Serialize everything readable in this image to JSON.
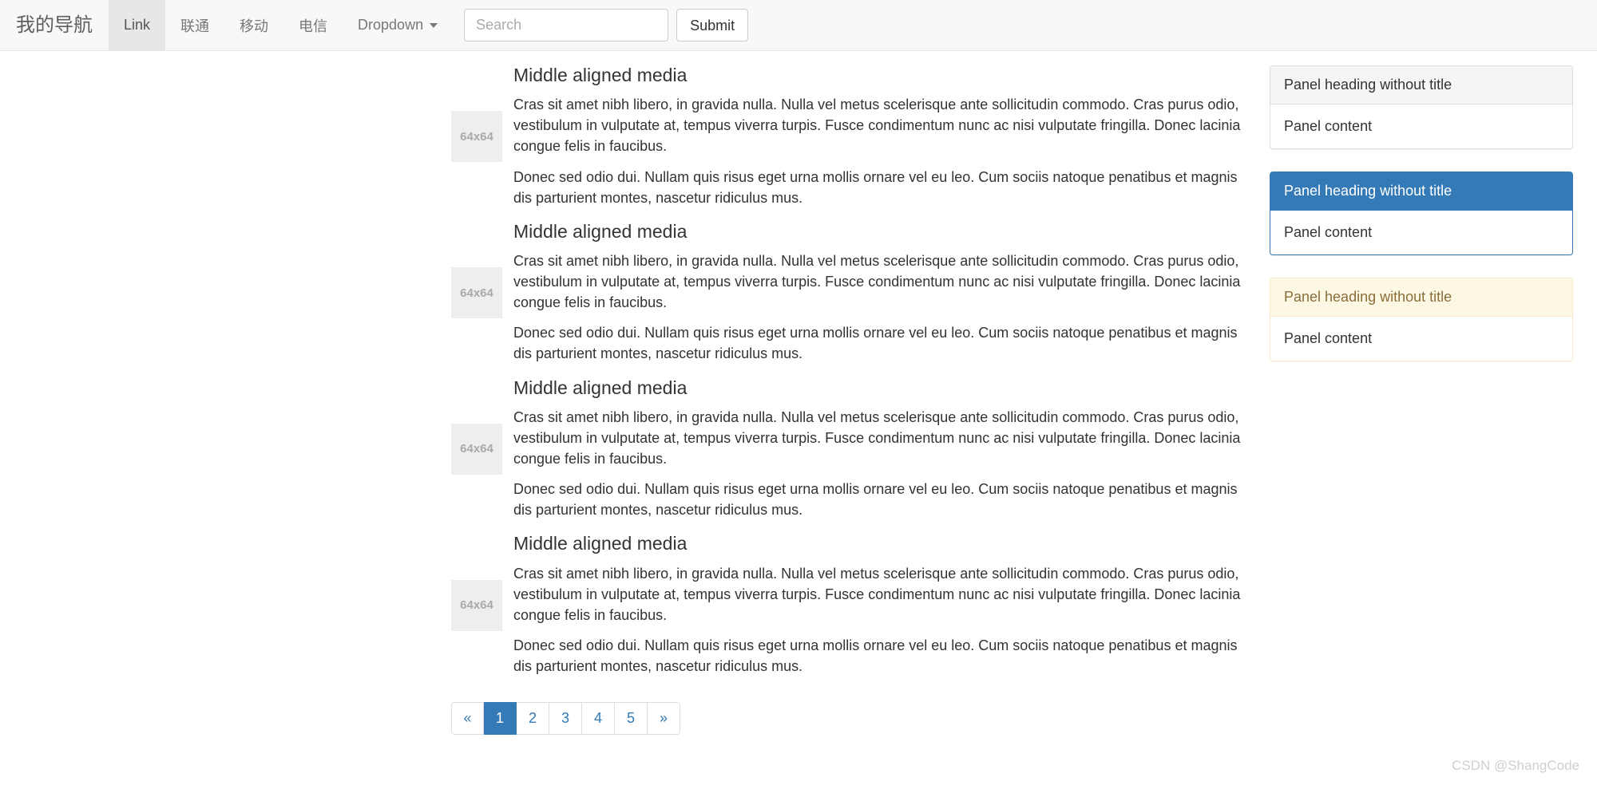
{
  "navbar": {
    "brand": "我的导航",
    "items": [
      {
        "label": "Link",
        "active": true,
        "dropdown": false
      },
      {
        "label": "联通",
        "active": false,
        "dropdown": false
      },
      {
        "label": "移动",
        "active": false,
        "dropdown": false
      },
      {
        "label": "电信",
        "active": false,
        "dropdown": false
      },
      {
        "label": "Dropdown",
        "active": false,
        "dropdown": true
      }
    ],
    "search": {
      "value": "",
      "placeholder": "Search"
    },
    "submit_label": "Submit"
  },
  "media_list": [
    {
      "thumb_label": "64x64",
      "heading": "Middle aligned media",
      "paragraph1": "Cras sit amet nibh libero, in gravida nulla. Nulla vel metus scelerisque ante sollicitudin commodo. Cras purus odio, vestibulum in vulputate at, tempus viverra turpis. Fusce condimentum nunc ac nisi vulputate fringilla. Donec lacinia congue felis in faucibus.",
      "paragraph2": "Donec sed odio dui. Nullam quis risus eget urna mollis ornare vel eu leo. Cum sociis natoque penatibus et magnis dis parturient montes, nascetur ridiculus mus."
    },
    {
      "thumb_label": "64x64",
      "heading": "Middle aligned media",
      "paragraph1": "Cras sit amet nibh libero, in gravida nulla. Nulla vel metus scelerisque ante sollicitudin commodo. Cras purus odio, vestibulum in vulputate at, tempus viverra turpis. Fusce condimentum nunc ac nisi vulputate fringilla. Donec lacinia congue felis in faucibus.",
      "paragraph2": "Donec sed odio dui. Nullam quis risus eget urna mollis ornare vel eu leo. Cum sociis natoque penatibus et magnis dis parturient montes, nascetur ridiculus mus."
    },
    {
      "thumb_label": "64x64",
      "heading": "Middle aligned media",
      "paragraph1": "Cras sit amet nibh libero, in gravida nulla. Nulla vel metus scelerisque ante sollicitudin commodo. Cras purus odio, vestibulum in vulputate at, tempus viverra turpis. Fusce condimentum nunc ac nisi vulputate fringilla. Donec lacinia congue felis in faucibus.",
      "paragraph2": "Donec sed odio dui. Nullam quis risus eget urna mollis ornare vel eu leo. Cum sociis natoque penatibus et magnis dis parturient montes, nascetur ridiculus mus."
    },
    {
      "thumb_label": "64x64",
      "heading": "Middle aligned media",
      "paragraph1": "Cras sit amet nibh libero, in gravida nulla. Nulla vel metus scelerisque ante sollicitudin commodo. Cras purus odio, vestibulum in vulputate at, tempus viverra turpis. Fusce condimentum nunc ac nisi vulputate fringilla. Donec lacinia congue felis in faucibus.",
      "paragraph2": "Donec sed odio dui. Nullam quis risus eget urna mollis ornare vel eu leo. Cum sociis natoque penatibus et magnis dis parturient montes, nascetur ridiculus mus."
    }
  ],
  "pagination": {
    "prev_label": "«",
    "next_label": "»",
    "pages": [
      "1",
      "2",
      "3",
      "4",
      "5"
    ],
    "active_page": "1"
  },
  "panels": [
    {
      "variant": "default",
      "heading": "Panel heading without title",
      "body": "Panel content"
    },
    {
      "variant": "primary",
      "heading": "Panel heading without title",
      "body": "Panel content"
    },
    {
      "variant": "warning",
      "heading": "Panel heading without title",
      "body": "Panel content"
    }
  ],
  "watermark": "CSDN @ShangCode",
  "colors": {
    "primary": "#337ab7",
    "navbar_bg": "#f8f8f8",
    "navbar_active_bg": "#e7e7e7",
    "panel_warning_bg": "#fcf8e3",
    "panel_warning_text": "#8a6d3b",
    "thumb_bg": "#eeeeee"
  }
}
